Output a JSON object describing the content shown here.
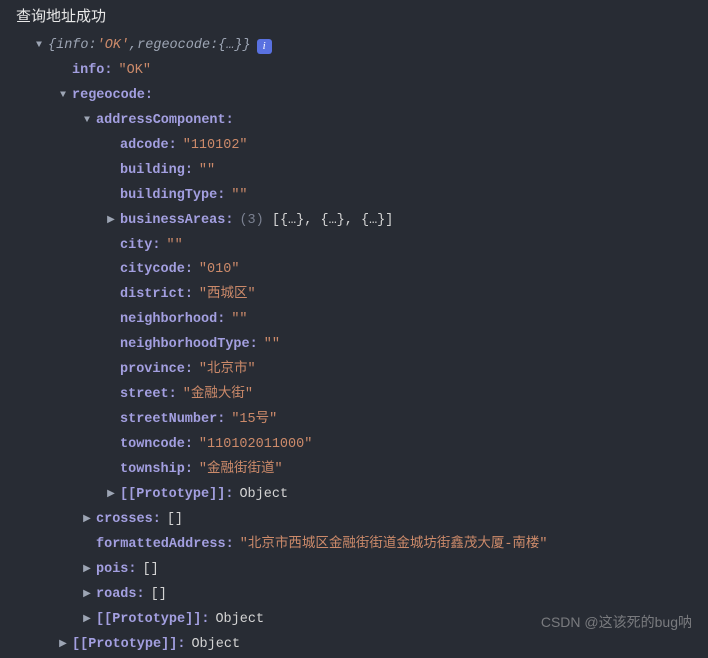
{
  "title": "查询地址成功",
  "summary": {
    "infoKey": "info",
    "infoVal": "'OK'",
    "regeocodeKey": "regeocode",
    "braces": "{…}"
  },
  "infoBadge": "i",
  "root": {
    "info": {
      "key": "info",
      "value": "\"OK\""
    },
    "regeocode": {
      "key": "regeocode",
      "addressComponent": {
        "key": "addressComponent",
        "adcode": {
          "key": "adcode",
          "value": "\"110102\""
        },
        "building": {
          "key": "building",
          "value": "\"\""
        },
        "buildingType": {
          "key": "buildingType",
          "value": "\"\""
        },
        "businessAreas": {
          "key": "businessAreas",
          "count": "(3)",
          "preview": "[{…}, {…}, {…}]"
        },
        "city": {
          "key": "city",
          "value": "\"\""
        },
        "citycode": {
          "key": "citycode",
          "value": "\"010\""
        },
        "district": {
          "key": "district",
          "value": "\"西城区\""
        },
        "neighborhood": {
          "key": "neighborhood",
          "value": "\"\""
        },
        "neighborhoodType": {
          "key": "neighborhoodType",
          "value": "\"\""
        },
        "province": {
          "key": "province",
          "value": "\"北京市\""
        },
        "street": {
          "key": "street",
          "value": "\"金融大街\""
        },
        "streetNumber": {
          "key": "streetNumber",
          "value": "\"15号\""
        },
        "towncode": {
          "key": "towncode",
          "value": "\"110102011000\""
        },
        "township": {
          "key": "township",
          "value": "\"金融街街道\""
        },
        "prototype": {
          "key": "[[Prototype]]",
          "value": "Object"
        }
      },
      "crosses": {
        "key": "crosses",
        "value": "[]"
      },
      "formattedAddress": {
        "key": "formattedAddress",
        "value": "\"北京市西城区金融街街道金城坊街鑫茂大厦-南楼\""
      },
      "pois": {
        "key": "pois",
        "value": "[]"
      },
      "roads": {
        "key": "roads",
        "value": "[]"
      },
      "prototype": {
        "key": "[[Prototype]]",
        "value": "Object"
      }
    },
    "prototype": {
      "key": "[[Prototype]]",
      "value": "Object"
    }
  },
  "watermark": "CSDN @这该死的bug呐"
}
